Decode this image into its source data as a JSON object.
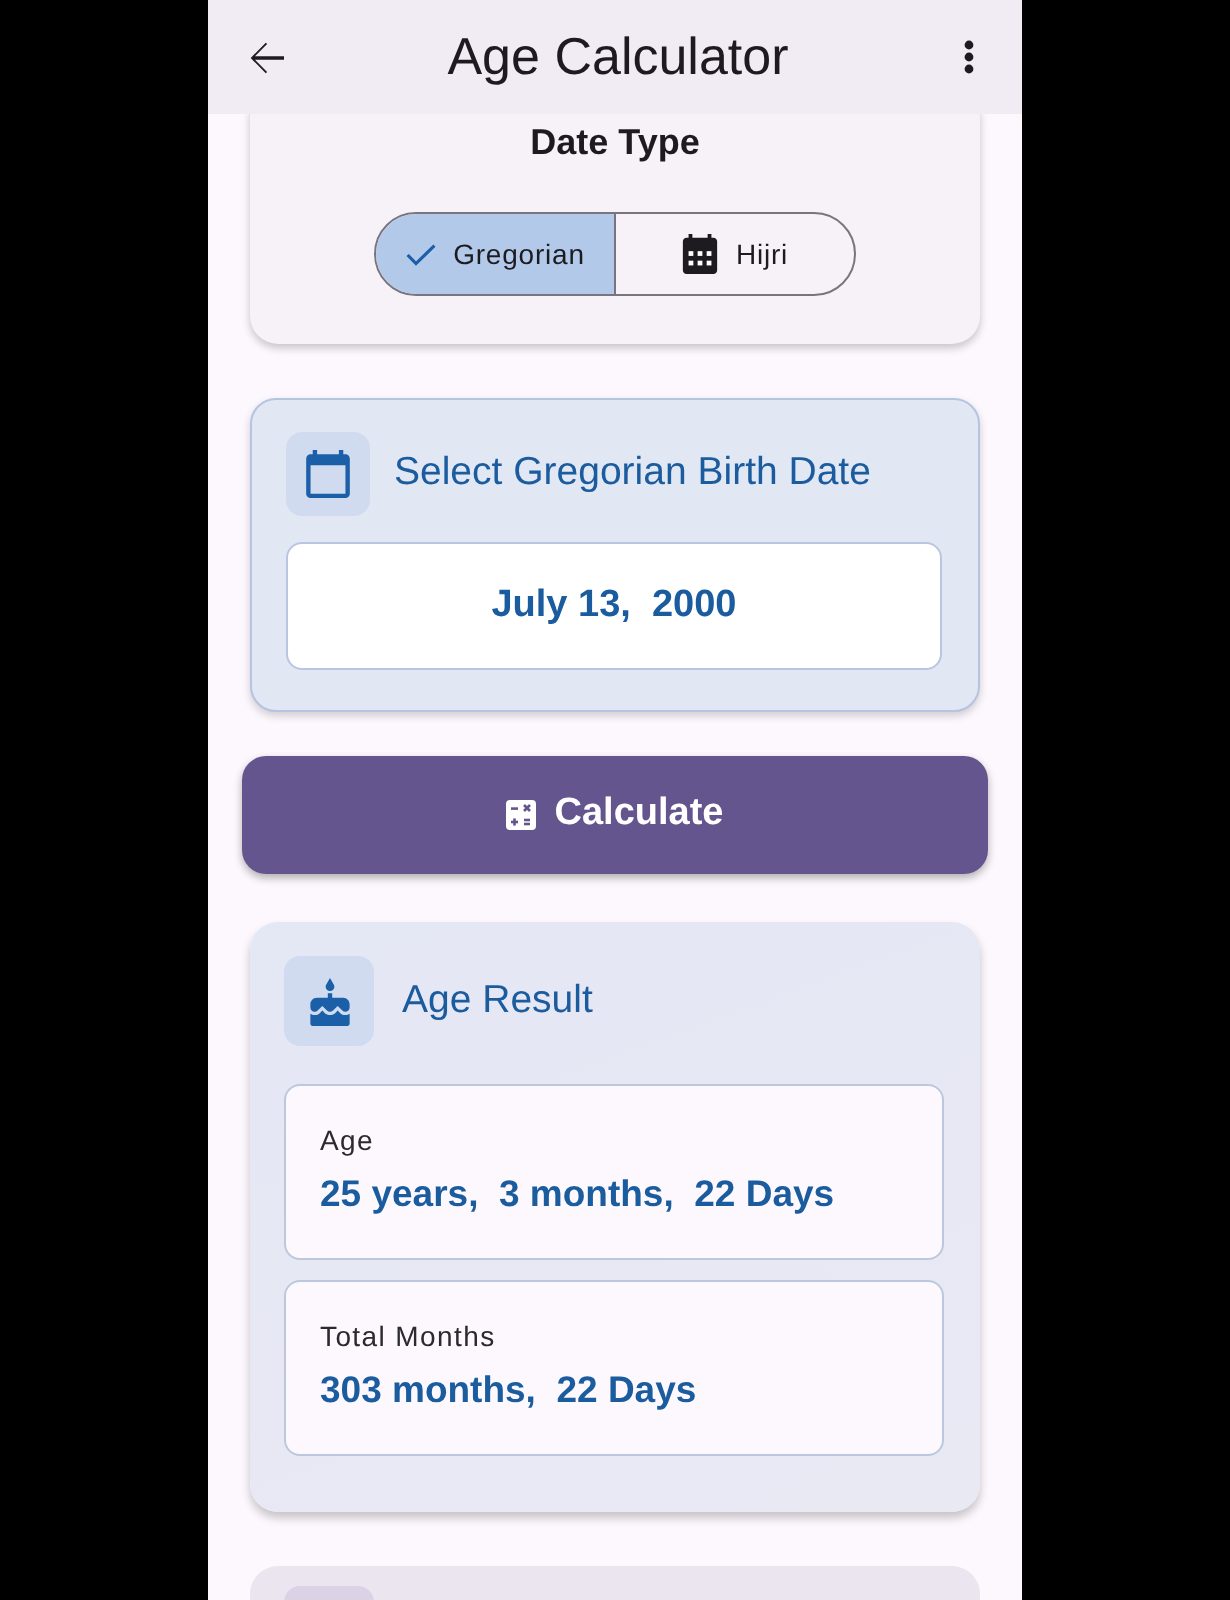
{
  "app_bar": {
    "title": "Age Calculator"
  },
  "date_type": {
    "title": "Date Type",
    "options": [
      {
        "label": "Gregorian",
        "selected": true
      },
      {
        "label": "Hijri",
        "selected": false
      }
    ]
  },
  "birth_date": {
    "title": "Select Gregorian Birth Date",
    "value": "July 13,  2000"
  },
  "calculate_button": {
    "label": "Calculate"
  },
  "age_result": {
    "title": "Age Result",
    "items": [
      {
        "label": "Age",
        "value": "25 years,  3 months,  22 Days"
      },
      {
        "label": "Total Months",
        "value": "303 months,  22 Days"
      }
    ]
  }
}
